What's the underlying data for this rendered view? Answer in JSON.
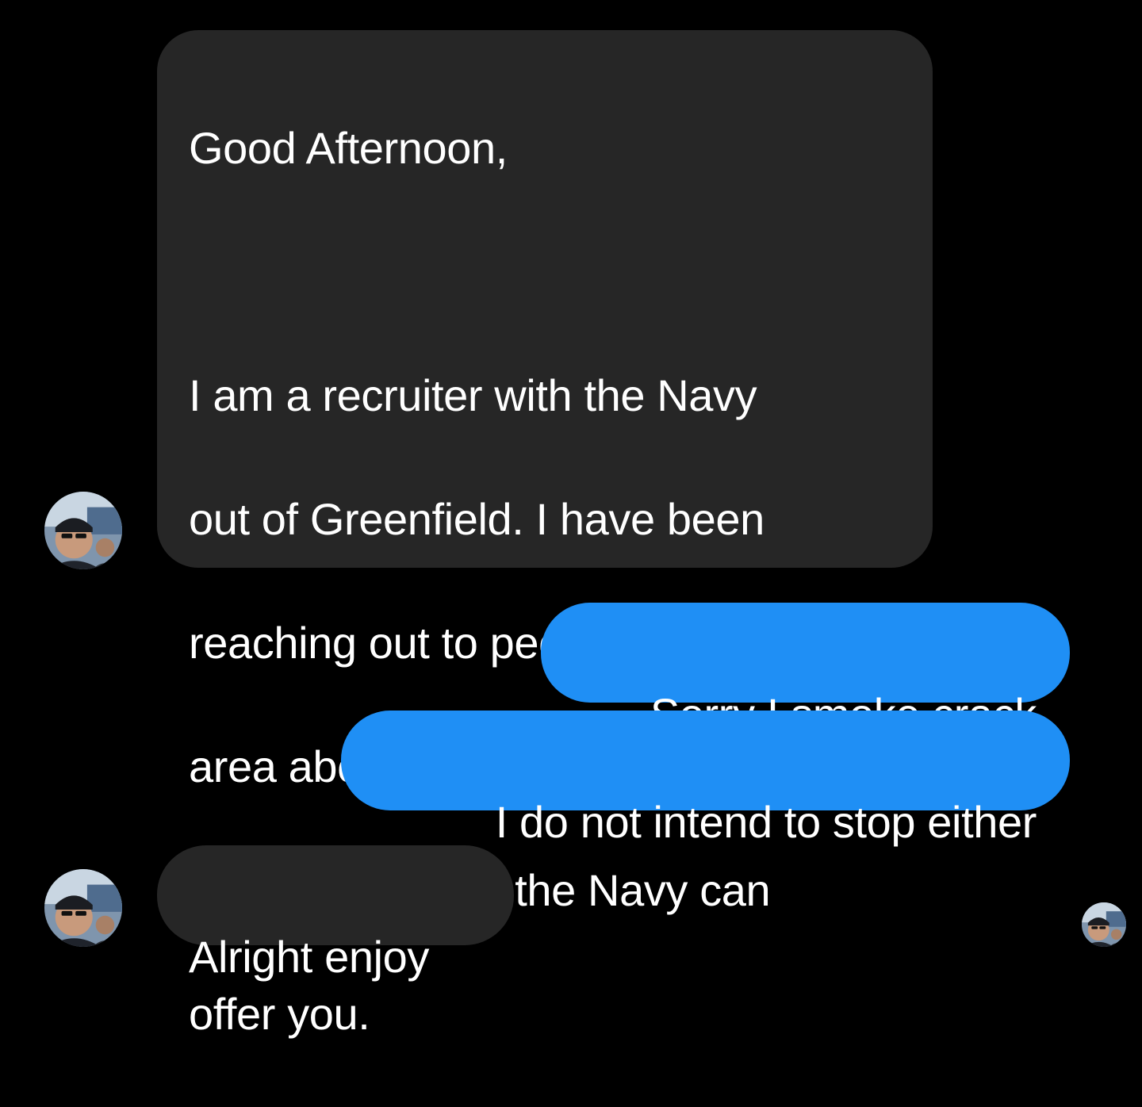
{
  "conversation": {
    "messages": [
      {
        "sender": "recruiter",
        "lines": [
          "Good Afternoon,",
          "",
          "I am a recruiter with the Navy",
          "out of Greenfield. I have been",
          "reaching out to people in the",
          "area about the Opportunities",
          "and Advantages the Navy can",
          "offer you."
        ]
      },
      {
        "sender": "me",
        "text": "Sorry I smoke crack"
      },
      {
        "sender": "me",
        "text": "I do not intend to stop either"
      },
      {
        "sender": "recruiter",
        "text": "Alright enjoy"
      }
    ]
  },
  "colors": {
    "background": "#000000",
    "incoming_bubble": "#262626",
    "outgoing_bubble": "#1f8ff5",
    "text": "#ffffff"
  },
  "icons": {
    "sender_avatar": "profile-photo-avatar",
    "read_receipt": "read-receipt-avatar"
  }
}
